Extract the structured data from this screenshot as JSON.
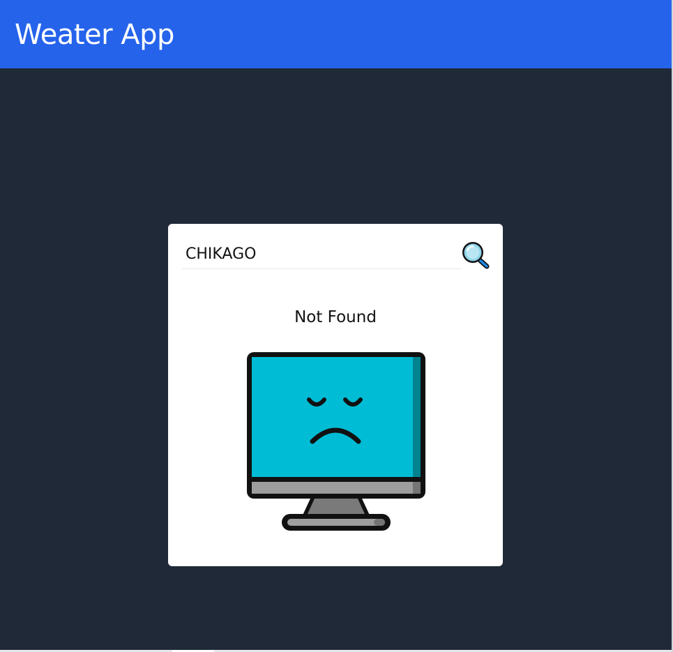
{
  "app": {
    "title": "Weater App"
  },
  "search": {
    "value": "CHIKAGO",
    "placeholder": "",
    "button_icon": "magnifier-icon"
  },
  "result": {
    "status_text": "Not Found",
    "illustration": "sad-computer-icon"
  },
  "colors": {
    "header": "#2563eb",
    "background": "#1f2937",
    "card": "#ffffff",
    "screen": "#00bcd4"
  }
}
